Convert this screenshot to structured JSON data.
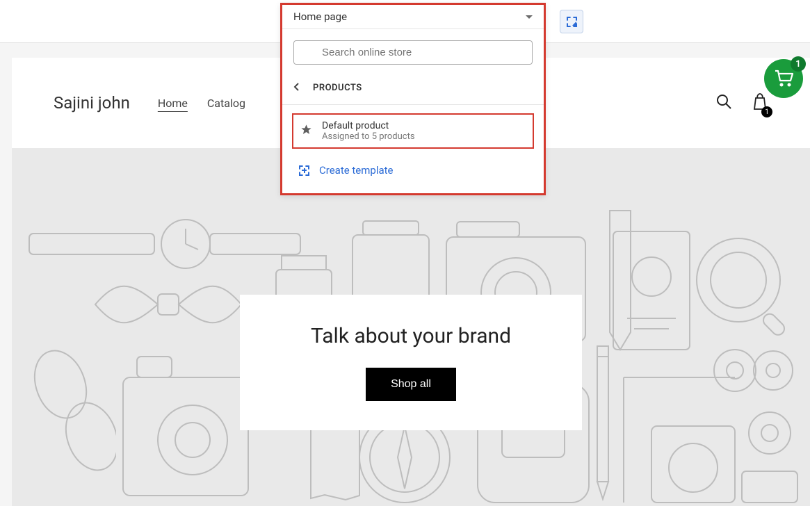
{
  "dropdown": {
    "current": "Home page",
    "search_placeholder": "Search online store",
    "products_label": "PRODUCTS",
    "default_product": {
      "title": "Default product",
      "subtitle": "Assigned to 5 products"
    },
    "create_label": "Create template"
  },
  "store": {
    "name": "Sajini john",
    "nav": {
      "home": "Home",
      "catalog": "Catalog"
    },
    "bag_count": "1",
    "hero": {
      "title": "Talk about your brand",
      "cta": "Shop all"
    }
  },
  "cart_fab": {
    "count": "1"
  }
}
